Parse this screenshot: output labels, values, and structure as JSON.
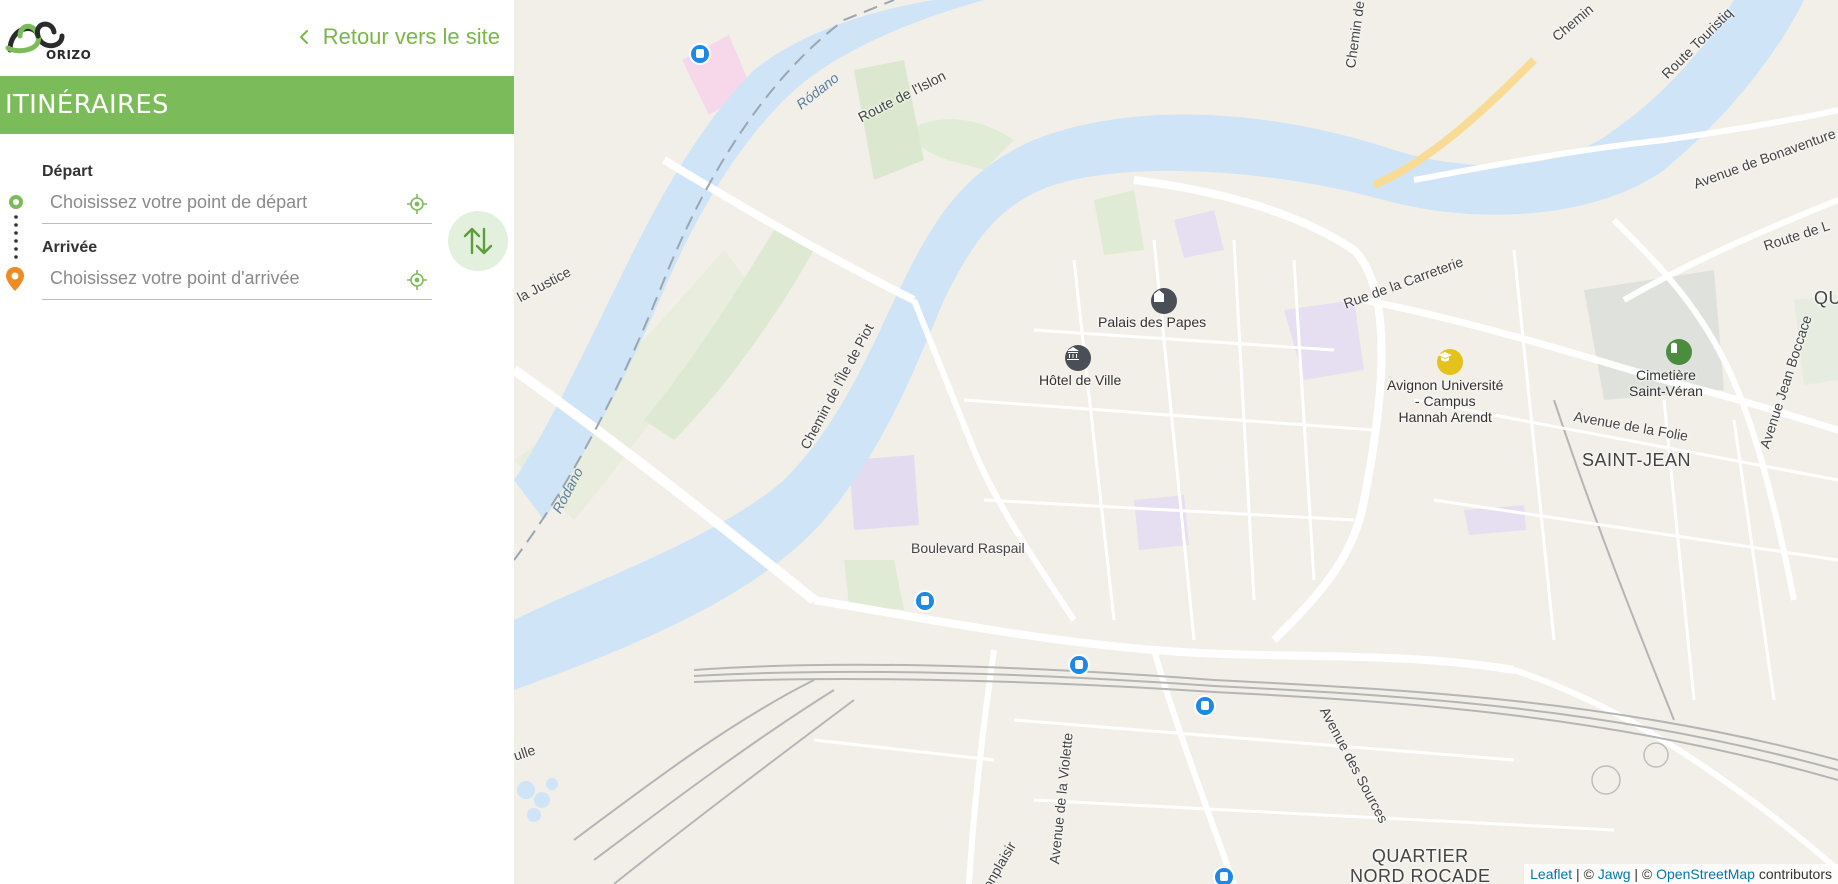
{
  "brand": {
    "logo_text": "ORIZO"
  },
  "header": {
    "back_link": "Retour vers le site"
  },
  "title": "ITINÉRAIRES",
  "form": {
    "departure_label": "Départ",
    "departure_placeholder": "Choisissez votre point de départ",
    "departure_value": "",
    "arrival_label": "Arrivée",
    "arrival_placeholder": "Choisissez votre point d'arrivée",
    "arrival_value": ""
  },
  "colors": {
    "brand_green": "#7cbb5a",
    "arrival_orange": "#f08a24",
    "water": "#cfe4f6",
    "bus_blue": "#1e88e5"
  },
  "map": {
    "pois": {
      "palais": "Palais des Papes",
      "hotel": "Hôtel de Ville",
      "univ_line1": "Avignon Université",
      "univ_line2": "- Campus",
      "univ_line3": "Hannah Arendt",
      "cemetery_line1": "Cimetière",
      "cemetery_line2": "Saint-Véran"
    },
    "districts": {
      "saint_jean": "SAINT-JEAN",
      "nord_line1": "QUARTIER",
      "nord_line2": "NORD ROCADE",
      "qu": "QU"
    },
    "roads": {
      "islon": "Route de l'Islon",
      "chemin_top": "Chemin de",
      "chemin_top_right": "Chemin",
      "touristique": "Route Touristiq",
      "bonaventure": "Avenue de Bonaventure",
      "route_l": "Route de L",
      "carreterie": "Rue de la Carreterie",
      "justice": "la Justice",
      "ile_piot": "Chemin de l'Île de Piot",
      "raspail": "Boulevard Raspail",
      "folie": "Avenue de la Folie",
      "boccace": "Avenue Jean Boccace",
      "violette": "Avenue de la Violette",
      "sources": "Avenue des Sources",
      "onplaisir": "onplaisir",
      "ulle": "ulle"
    },
    "rivers": {
      "rodano_top": "Ródano",
      "rodano_left": "Ródano"
    },
    "attribution": {
      "leaflet": "Leaflet",
      "sep1": " | © ",
      "jawg": "Jawg",
      "sep2": " | © ",
      "osm": "OpenStreetMap",
      "suffix": " contributors"
    }
  },
  "icons": [
    "back-chevron-icon",
    "departure-marker-icon",
    "arrival-marker-icon",
    "locate-icon",
    "swap-icon",
    "bus-stop-icon",
    "monument-icon",
    "university-icon",
    "cemetery-icon"
  ]
}
